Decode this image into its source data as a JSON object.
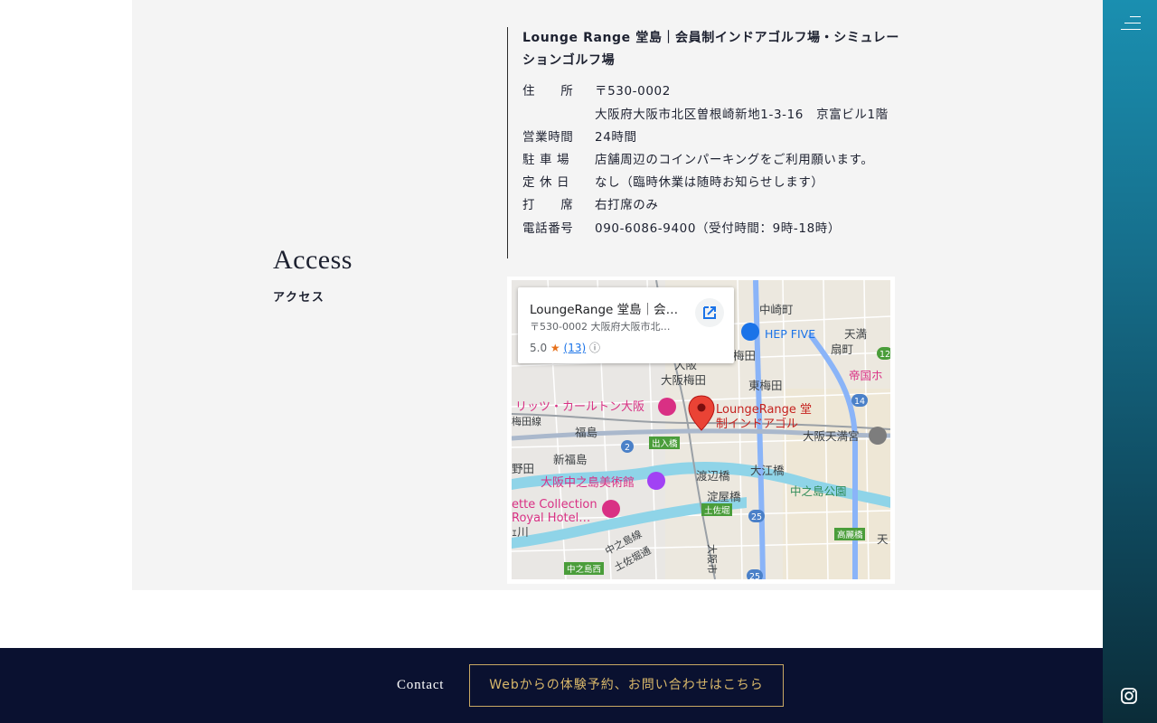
{
  "access": {
    "heading_en": "Access",
    "heading_ja": "アクセス",
    "store_name": "Lounge Range 堂島｜会員制インドアゴルフ場・シミュレーションゴルフ場",
    "rows": [
      {
        "label": "住　　所",
        "value": "〒530-0002"
      },
      {
        "label": "",
        "value": "大阪府大阪市北区曽根崎新地1-3-16　京富ビル1階"
      },
      {
        "label": "営業時間",
        "value": "24時間"
      },
      {
        "label": "駐 車 場",
        "value": "店舗周辺のコインパーキングをご利用願います。"
      },
      {
        "label": "定 休 日",
        "value": "なし（臨時休業は随時お知らせします）"
      },
      {
        "label": "打　　席",
        "value": "右打席のみ"
      },
      {
        "label": "電話番号",
        "value": "090-6086-9400（受付時間：9時-18時）"
      }
    ]
  },
  "map": {
    "card_title": "LoungeRange 堂島｜会…",
    "card_address": "〒530-0002 大阪府大阪市北…",
    "rating": "5.0",
    "review_count": "(13)",
    "open_icon": "external-link-icon",
    "labels": {
      "nakazakicho": "中崎町",
      "hep": "HEP FIVE",
      "tenma": "天満",
      "ougimachi": "扇町",
      "umeda": "梅田",
      "osaka": "大阪",
      "osaka_umeda": "大阪梅田",
      "higashi_umeda": "東梅田",
      "teikoku": "帝国ホ",
      "ritz": "リッツ・カールトン大阪",
      "umedasen": "梅田線",
      "fukushima": "福島",
      "deirihashi": "出入橋",
      "pin_line1": "LoungeRange 堂",
      "pin_line2": "制インドアゴル",
      "tenmangu": "大阪天満宮",
      "shinfukushima": "新福島",
      "noda": "野田",
      "nakanoshima_museum": "大阪中之島美術館",
      "watanabebashi": "渡辺橋",
      "oebashi": "大江橋",
      "nakanoshima_park": "中之島公園",
      "collection": "ette Collection",
      "royal": "Royal Hotel…",
      "kawa": "ｪ川",
      "yodoyabashi": "淀屋橋",
      "tosabori": "土佐堀",
      "nakanoshima_line": "中之島線",
      "tosabori_dori": "土佐堀通",
      "koraibashi": "高麗橋",
      "ten": "天",
      "nakanoshima_nishi": "中之島西",
      "osakashi": "大阪市",
      "r2": "2",
      "r25a": "25",
      "r25b": "25",
      "r14": "14",
      "r12": "12"
    }
  },
  "footer": {
    "contact_label": "Contact",
    "cta_label": "Webからの体験予約、お問い合わせはこちら"
  },
  "sidebar": {
    "menu_icon": "hamburger-menu-icon",
    "social_icon": "instagram-icon"
  },
  "colors": {
    "footer_bg": "#0a1130",
    "cta_accent": "#d9b86a",
    "sidebar_top": "#1a8fb0",
    "sidebar_bottom": "#0b2c38",
    "map_pin": "#ea4335"
  }
}
